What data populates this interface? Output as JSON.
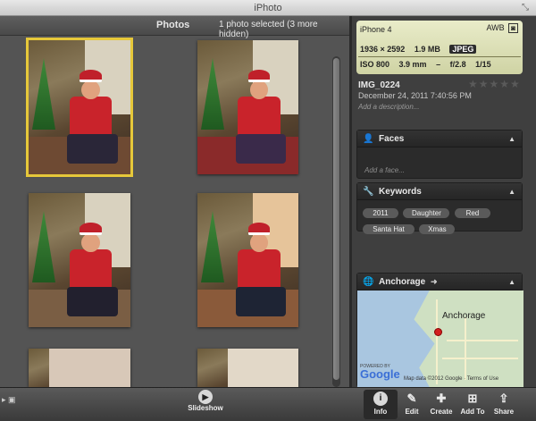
{
  "window": {
    "title": "iPhoto",
    "resize_glyph": "⤡"
  },
  "grid": {
    "title": "Photos",
    "selection_status": "1 photo selected (3 more hidden)"
  },
  "exif": {
    "camera": "iPhone 4",
    "camera_icons": [
      "AWB",
      "◙"
    ],
    "resolution": "1936 × 2592",
    "file_size": "1.9 MB",
    "format": "JPEG",
    "iso": "ISO 800",
    "focal_length": "3.9 mm",
    "exposure_bias": "–",
    "aperture": "f/2.8",
    "shutter": "1/15"
  },
  "meta": {
    "name": "IMG_0224",
    "date": "December 24, 2011 7:40:56 PM",
    "description_placeholder": "Add a description...",
    "stars": "★★★★★"
  },
  "faces": {
    "title": "Faces",
    "placeholder": "Add a face..."
  },
  "keywords": {
    "title": "Keywords",
    "items": [
      "2011",
      "Daughter",
      "Red",
      "Santa Hat",
      "Xmas"
    ]
  },
  "location": {
    "title": "Anchorage",
    "map_label": "Anchorage",
    "powered_by": "POWERED BY",
    "google": "Google",
    "copyright": "Map data ©2012 Google ·  Terms of Use"
  },
  "toolbar": {
    "slideshow": "Slideshow",
    "info": "Info",
    "edit": "Edit",
    "create": "Create",
    "add_to": "Add To",
    "share": "Share"
  },
  "colors": {
    "selection": "#e6c83a",
    "panel_bg": "#2b2b2b",
    "exif_bg": "#dfe2b6"
  }
}
